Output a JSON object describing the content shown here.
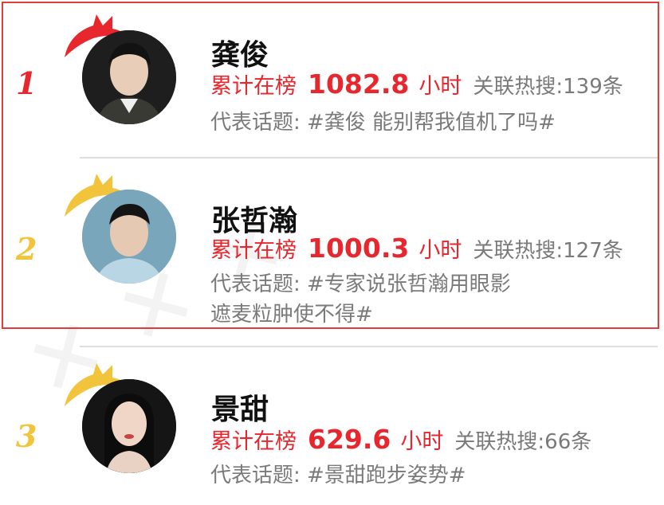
{
  "entries": [
    {
      "rank": "1",
      "name": "龚俊",
      "stat_label": "累计在榜",
      "hours": "1082.8",
      "hours_unit": "小时",
      "related": "关联热搜:139条",
      "topic": "代表话题: #龚俊 能别帮我值机了吗#"
    },
    {
      "rank": "2",
      "name": "张哲瀚",
      "stat_label": "累计在榜",
      "hours": "1000.3",
      "hours_unit": "小时",
      "related": "关联热搜:127条",
      "topic": "代表话题: #专家说张哲瀚用眼影遮麦粒肿使不得#"
    },
    {
      "rank": "3",
      "name": "景甜",
      "stat_label": "累计在榜",
      "hours": "629.6",
      "hours_unit": "小时",
      "related": "关联热搜:66条",
      "topic": "代表话题: #景甜跑步姿势#"
    }
  ],
  "colors": {
    "accent_red": "#e8262d",
    "rank_gold": "#f2c43c",
    "border": "#e23b3b",
    "gray_text": "#7a7a7a"
  }
}
